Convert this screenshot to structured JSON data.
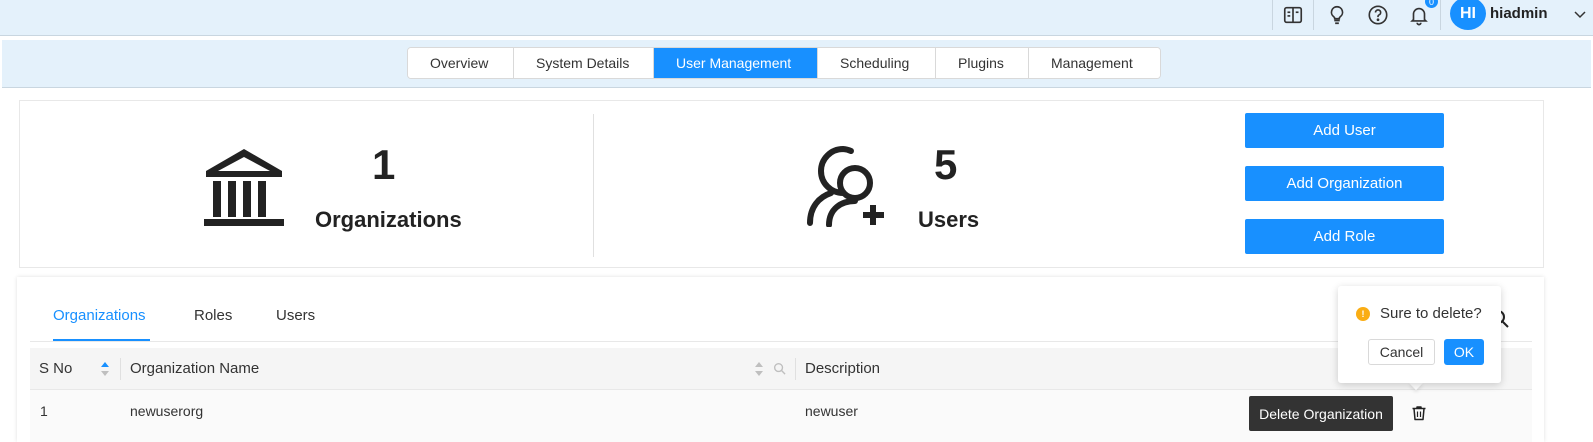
{
  "header": {
    "user_initials": "HI",
    "username": "hiadmin",
    "notification_count": "0",
    "icons": [
      "book-icon",
      "lightbulb-icon",
      "help-icon",
      "bell-icon"
    ]
  },
  "nav": {
    "tabs": [
      {
        "label": "Overview"
      },
      {
        "label": "System Details"
      },
      {
        "label": "User Management"
      },
      {
        "label": "Scheduling"
      },
      {
        "label": "Plugins"
      },
      {
        "label": "Management"
      }
    ],
    "active": "User Management"
  },
  "stats": {
    "organizations": {
      "count": "1",
      "label": "Organizations"
    },
    "users": {
      "count": "5",
      "label": "Users"
    }
  },
  "actions": {
    "add_user": "Add User",
    "add_organization": "Add Organization",
    "add_role": "Add Role"
  },
  "subtabs": [
    "Organizations",
    "Roles",
    "Users"
  ],
  "table": {
    "columns": [
      "S No",
      "Organization Name",
      "Description"
    ],
    "rows": [
      {
        "sno": "1",
        "name": "newuserorg",
        "description": "newuser"
      }
    ]
  },
  "tooltip": "Delete Organization",
  "popconfirm": {
    "message": "Sure to delete?",
    "cancel": "Cancel",
    "ok": "OK",
    "warn_glyph": "!"
  },
  "colors": {
    "accent": "#1890ff",
    "header_bg": "#e4f1fb",
    "warning": "#faad14",
    "tooltip_bg": "#333333"
  }
}
